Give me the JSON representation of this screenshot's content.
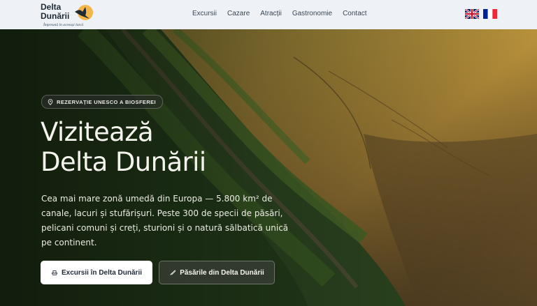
{
  "brand": {
    "line1": "Delta",
    "line2": "Dunării",
    "tagline": "Împreună în aceeași lotcă",
    "logo_icon": "pelican-sun-logo"
  },
  "nav": {
    "items": [
      {
        "label": "Excursii"
      },
      {
        "label": "Cazare"
      },
      {
        "label": "Atracții"
      },
      {
        "label": "Gastronomie"
      },
      {
        "label": "Contact"
      }
    ]
  },
  "languages": [
    {
      "icon": "uk-flag-icon"
    },
    {
      "icon": "fr-flag-icon"
    }
  ],
  "hero": {
    "badge": "REZERVAȚIE UNESCO A BIOSFEREI",
    "badge_icon": "location-pin-icon",
    "title_line1": "Vizitează",
    "title_line2": "Delta Dunării",
    "lead_lines": [
      "Cea mai mare zonă umedă din Europa — 5.800 km² de",
      "canale, lacuri și stufărișuri. Peste 300 de specii de păsări,",
      "pelicani comuni și creți, sturioni și o natură sălbatică unică",
      "pe continent."
    ],
    "primary_button": {
      "label": "Excursii în Delta Dunării",
      "icon": "boat-icon"
    },
    "secondary_button": {
      "label": "Păsările din Delta Dunării",
      "icon": "feather-icon"
    }
  },
  "colors": {
    "header_bg": "#eef2f6",
    "nav_text": "#3a4655",
    "primary_btn_bg": "#ffffff",
    "hero_text": "#f4f4ee"
  }
}
